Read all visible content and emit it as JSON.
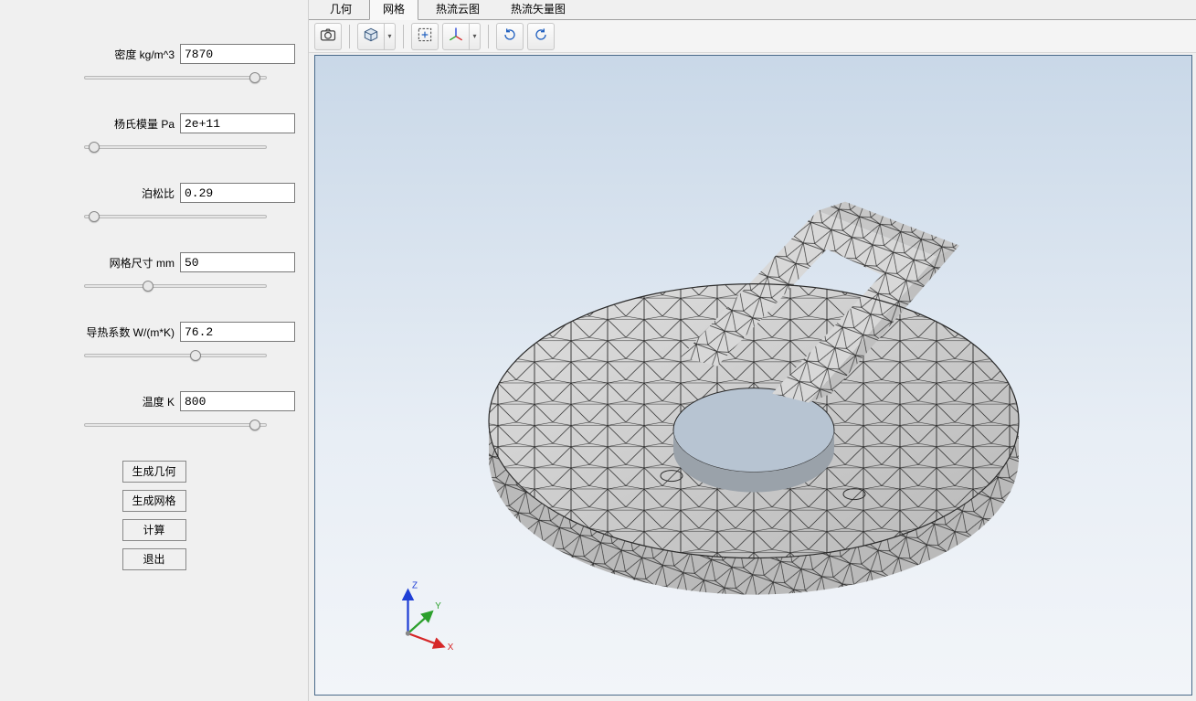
{
  "params": {
    "density": {
      "label": "密度 kg/m^3",
      "value": "7870",
      "slider": 97
    },
    "youngs": {
      "label": "杨氏模量 Pa",
      "value": "2e+11",
      "slider": 2
    },
    "poisson": {
      "label": "泊松比",
      "value": "0.29",
      "slider": 2
    },
    "meshsize": {
      "label": "网格尺寸 mm",
      "value": "50",
      "slider": 34
    },
    "thermcond": {
      "label": "导热系数 W/(m*K)",
      "value": "76.2",
      "slider": 62
    },
    "temp": {
      "label": "温度 K",
      "value": "800",
      "slider": 97
    }
  },
  "buttons": {
    "gen_geom": "生成几何",
    "gen_mesh": "生成网格",
    "compute": "计算",
    "exit": "退出"
  },
  "tabs": {
    "geom": "几何",
    "mesh": "网格",
    "heat_cloud": "热流云图",
    "heat_vec": "热流矢量图",
    "active": "mesh"
  },
  "triad": {
    "x": "X",
    "y": "Y",
    "z": "Z"
  },
  "colors": {
    "mesh_fill": "#cfcfcf",
    "mesh_stroke": "#2b2b2b",
    "axis_x": "#d62728",
    "axis_y": "#2ca02c",
    "axis_z": "#1f3fd6"
  }
}
